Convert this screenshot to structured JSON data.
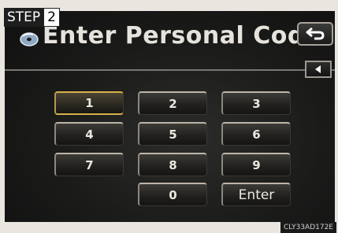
{
  "step": {
    "label": "STEP",
    "number": "2"
  },
  "screen": {
    "title": "Enter Personal Code",
    "title_icon": "cd-disc-icon",
    "back_icon": "return-arrow-icon",
    "scroll_icon": "left-triangle-icon"
  },
  "keypad": {
    "keys": [
      "1",
      "2",
      "3",
      "4",
      "5",
      "6",
      "7",
      "8",
      "9",
      "0",
      "Enter"
    ],
    "selected": "1"
  },
  "footer": {
    "code": "CLY33AD172E"
  },
  "colors": {
    "accent": "#d6b24c",
    "screen_bg": "#1a1a19"
  }
}
